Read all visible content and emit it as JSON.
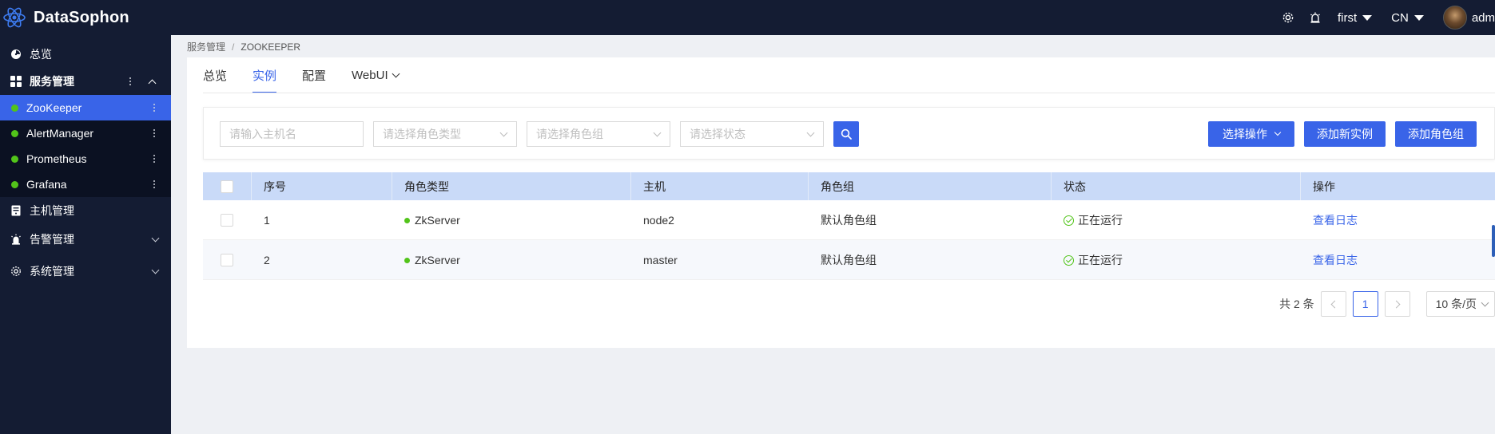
{
  "app": {
    "title": "DataSophon"
  },
  "header": {
    "settings_icon": "gear-icon",
    "alarm_icon": "alarm-light-icon",
    "cluster": "first",
    "language": "CN",
    "user": "adm"
  },
  "sidebar": {
    "items": [
      {
        "label": "总览",
        "icon": "dashboard-icon"
      },
      {
        "label": "服务管理",
        "icon": "apps-icon"
      },
      {
        "label": "主机管理",
        "icon": "server-icon"
      },
      {
        "label": "告警管理",
        "icon": "alarm-icon"
      },
      {
        "label": "系统管理",
        "icon": "settings-icon"
      }
    ],
    "services": [
      {
        "label": "ZooKeeper",
        "status_color": "#52c41a",
        "active": true
      },
      {
        "label": "AlertManager",
        "status_color": "#52c41a"
      },
      {
        "label": "Prometheus",
        "status_color": "#52c41a"
      },
      {
        "label": "Grafana",
        "status_color": "#52c41a"
      }
    ]
  },
  "breadcrumb": {
    "root": "服务管理",
    "sep": "/",
    "current": "ZOOKEEPER"
  },
  "tabs": [
    "总览",
    "实例",
    "配置",
    "WebUI"
  ],
  "filters": {
    "hostname_placeholder": "请输入主机名",
    "role_type_placeholder": "请选择角色类型",
    "role_group_placeholder": "请选择角色组",
    "status_placeholder": "请选择状态"
  },
  "actions": {
    "select_action": "选择操作",
    "add_instance": "添加新实例",
    "add_role_group": "添加角色组"
  },
  "table": {
    "columns": [
      "序号",
      "角色类型",
      "主机",
      "角色组",
      "状态",
      "操作"
    ],
    "rows": [
      {
        "index": "1",
        "role_type": "ZkServer",
        "host": "node2",
        "role_group": "默认角色组",
        "status": "正在运行",
        "action": "查看日志"
      },
      {
        "index": "2",
        "role_type": "ZkServer",
        "host": "master",
        "role_group": "默认角色组",
        "status": "正在运行",
        "action": "查看日志"
      }
    ]
  },
  "pagination": {
    "total": "共 2 条",
    "current_page": "1",
    "page_size": "10 条/页"
  },
  "colors": {
    "accent": "#3964e8",
    "sidebar_bg": "#141c33",
    "running": "#52c41a",
    "table_header": "#c9daf8"
  }
}
